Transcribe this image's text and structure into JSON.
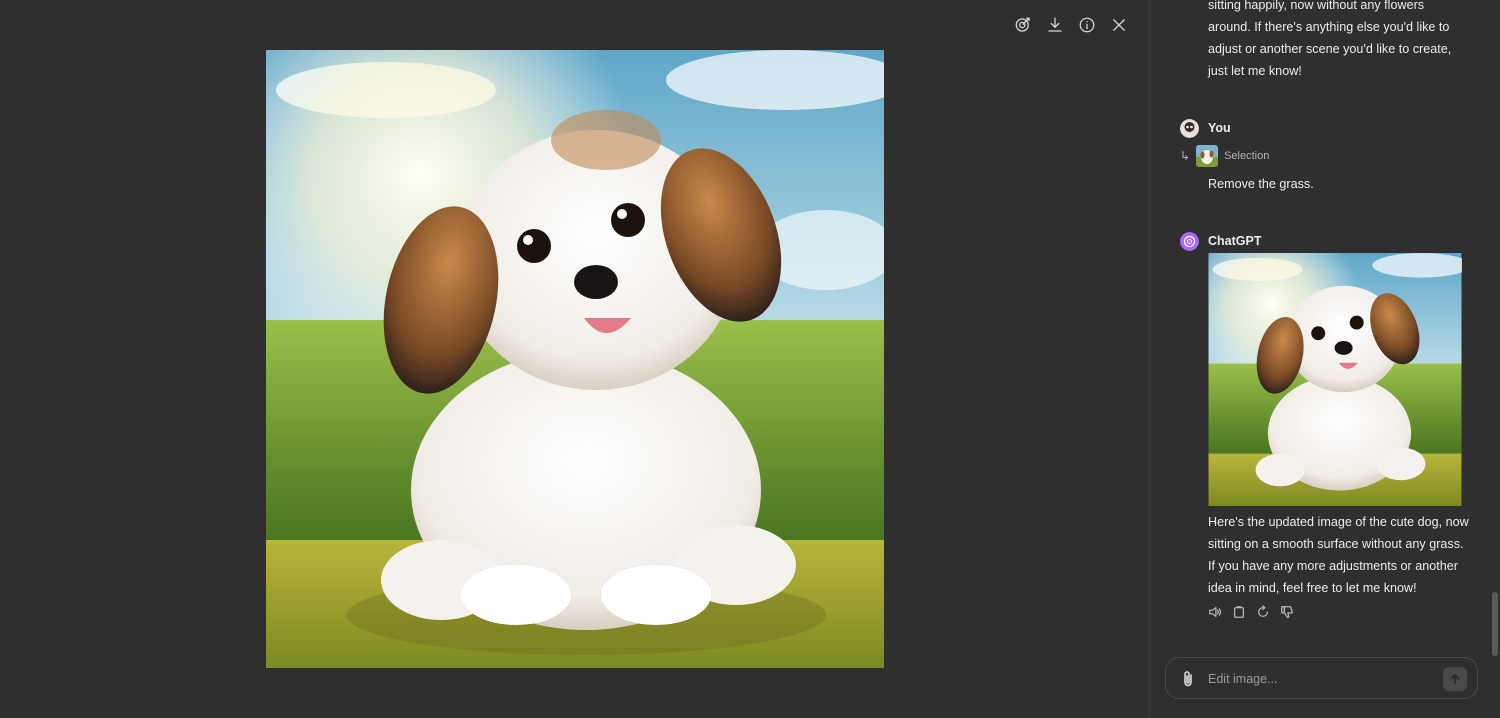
{
  "viewer": {
    "toolbar": {
      "edit": "edit-selection-icon",
      "download": "download-icon",
      "info": "info-icon",
      "close": "close-icon"
    },
    "image_name": "dog-image"
  },
  "chat": {
    "previous_message": "sitting happily, now without any flowers around. If there's anything else you'd like to adjust or another scene you'd like to create, just let me know!",
    "user_message": {
      "author": "You",
      "selection_label": "Selection",
      "text": "Remove the grass."
    },
    "assistant_message": {
      "author": "ChatGPT",
      "text": "Here's the updated image of the cute dog, now sitting on a smooth surface without any grass. If you have any more adjustments or another idea in mind, feel free to let me know!",
      "actions": [
        "read-aloud-icon",
        "copy-icon",
        "regenerate-icon",
        "thumbs-down-icon"
      ]
    },
    "composer": {
      "placeholder": "Edit image..."
    }
  },
  "colors": {
    "background": "#2f2f2f",
    "text": "#ececec",
    "muted": "#b4b4b4",
    "chatgpt_avatar": "#ab68ff"
  }
}
